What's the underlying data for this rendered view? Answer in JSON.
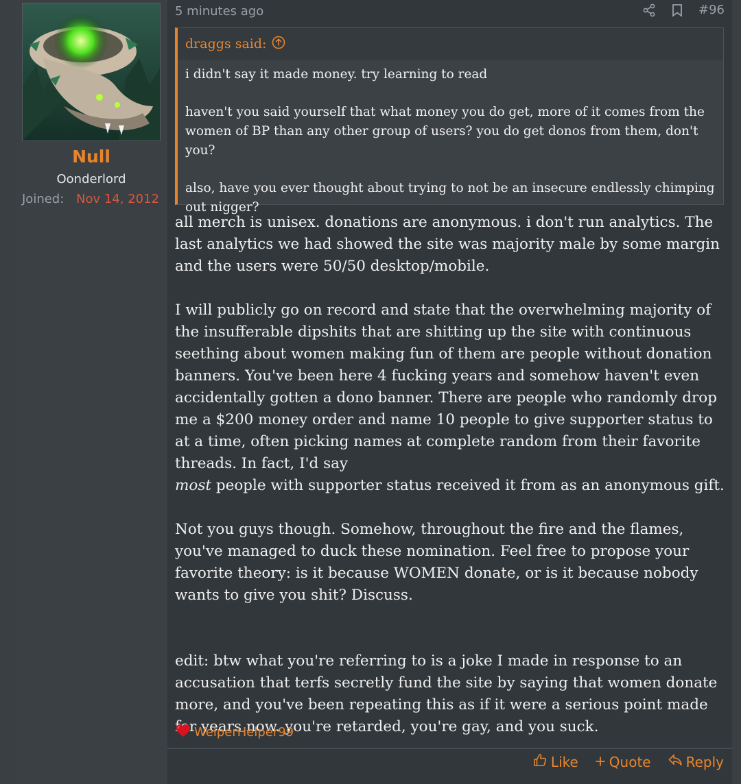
{
  "user": {
    "name": "Null",
    "title": "Oonderlord",
    "joined_label": "Joined:",
    "joined_date": "Nov 14, 2012"
  },
  "post": {
    "time": "5 minutes ago",
    "number": "#96",
    "quote": {
      "author_line": "draggs said:",
      "paragraphs": [
        "i didn't say it made money. try learning to read",
        "haven't you said yourself that what money you do get, more of it comes from the women of BP than any other group of users? you do get donos from them, don't you?",
        "also, have you ever thought about trying to not be an insecure endlessly chimping out nigger?"
      ]
    },
    "body": {
      "p1": "all merch is unisex. donations are anonymous. i don't run analytics. The last analytics we had showed the site was majority male by some margin and the users were 50/50 desktop/mobile.",
      "p2": "I will publicly go on record and state that the overwhelming majority of the insufferable dipshits that are shitting up the site with continuous seething about women making fun of them are people without donation banners. You've been here 4 fucking years and somehow haven't even accidentally gotten a dono banner. There are people who randomly drop me a $200 money order and name 10 people to give supporter status to at a time, often picking names at complete random from their favorite threads. In fact, I'd say",
      "p2_em": "most",
      "p2_tail": " people with supporter status received it from as an anonymous gift.",
      "p3": "Not you guys though. Somehow, throughout the fire and the flames, you've managed to duck these nomination. Feel free to propose your favorite theory: is it because WOMEN donate, or is it because nobody wants to give you shit? Discuss.",
      "p4": "edit: btw what you're referring to is a joke I made in response to an accusation that terfs secretly fund the site by saying that women donate more, and you've been repeating this as if it were a serious point made for years now. you're retarded, you're gay, and you suck."
    },
    "reaction_user": "WelperHelper99"
  },
  "actions": {
    "like": "Like",
    "quote": "Quote",
    "reply": "Reply"
  },
  "colors": {
    "accent": "#e8852c",
    "joined_date": "#d9573f",
    "background": "#32373b",
    "sidebar": "#3b4045"
  },
  "icons": [
    "share-icon",
    "bookmark-icon",
    "arrow-up-circle-icon",
    "heart-icon",
    "thumbs-up-icon",
    "plus-icon",
    "reply-arrow-icon"
  ]
}
